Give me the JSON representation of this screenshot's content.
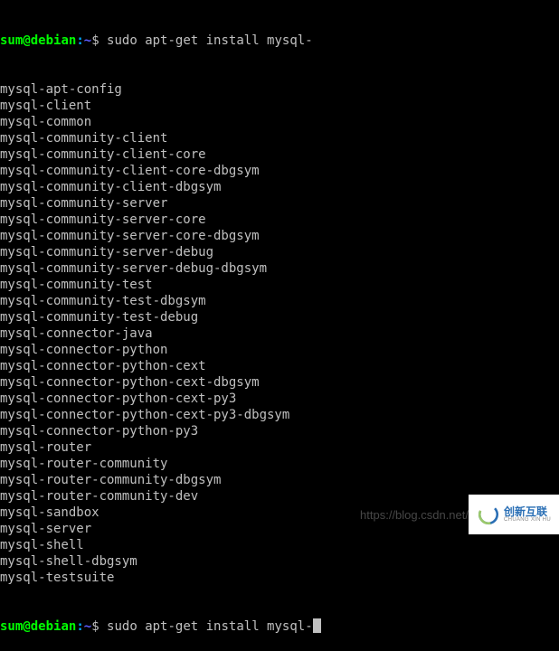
{
  "prompt1": {
    "user": "sum",
    "at": "@",
    "host": "debian",
    "colon": ":",
    "path": "~",
    "dollar": "$ ",
    "command": "sudo apt-get install mysql-"
  },
  "completions": [
    "mysql-apt-config",
    "mysql-client",
    "mysql-common",
    "mysql-community-client",
    "mysql-community-client-core",
    "mysql-community-client-core-dbgsym",
    "mysql-community-client-dbgsym",
    "mysql-community-server",
    "mysql-community-server-core",
    "mysql-community-server-core-dbgsym",
    "mysql-community-server-debug",
    "mysql-community-server-debug-dbgsym",
    "mysql-community-test",
    "mysql-community-test-dbgsym",
    "mysql-community-test-debug",
    "mysql-connector-java",
    "mysql-connector-python",
    "mysql-connector-python-cext",
    "mysql-connector-python-cext-dbgsym",
    "mysql-connector-python-cext-py3",
    "mysql-connector-python-cext-py3-dbgsym",
    "mysql-connector-python-py3",
    "mysql-router",
    "mysql-router-community",
    "mysql-router-community-dbgsym",
    "mysql-router-community-dev",
    "mysql-sandbox",
    "mysql-server",
    "mysql-shell",
    "mysql-shell-dbgsym",
    "mysql-testsuite"
  ],
  "prompt2": {
    "user": "sum",
    "at": "@",
    "host": "debian",
    "colon": ":",
    "path": "~",
    "dollar": "$ ",
    "command": "sudo apt-get install mysql-"
  },
  "watermark": {
    "url": "https://blog.csdn.net/",
    "logo_main": "创新互联",
    "logo_sub": "CHUANG XIN HU"
  }
}
